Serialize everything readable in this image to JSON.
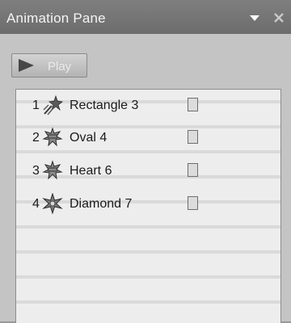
{
  "pane": {
    "title": "Animation Pane"
  },
  "icons": {
    "dropdown": "triangle-down-icon",
    "close": "close-x-icon",
    "play": "play-triangle-icon"
  },
  "toolbar": {
    "play_label": "Play"
  },
  "animation_items": [
    {
      "number": "1",
      "name": "Rectangle 3",
      "icon": "fly-in-star-icon"
    },
    {
      "number": "2",
      "name": "Oval 4",
      "icon": "burst-star-icon"
    },
    {
      "number": "3",
      "name": "Heart 6",
      "icon": "burst-star-icon"
    },
    {
      "number": "4",
      "name": "Diamond 7",
      "icon": "spark-star-icon"
    }
  ]
}
